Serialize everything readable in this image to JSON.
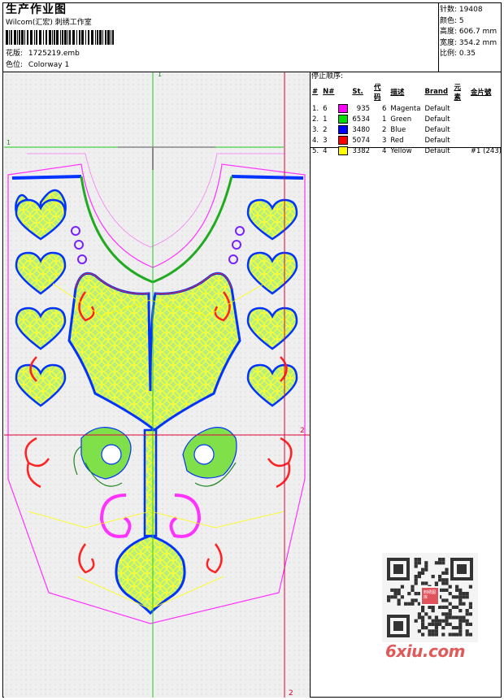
{
  "header": {
    "title": "生产作业图",
    "company": "Wilcom(汇宏) 刺绣工作室",
    "design_label": "花版:",
    "design_value": "1725219.emb",
    "colorway_label": "色位:",
    "colorway_value": "Colorway 1"
  },
  "stats": [
    {
      "label": "针数",
      "value": "19408"
    },
    {
      "label": "颜色",
      "value": "5"
    },
    {
      "label": "高度",
      "value": "606.7 mm"
    },
    {
      "label": "宽度",
      "value": "354.2 mm"
    },
    {
      "label": "比例",
      "value": "0.35"
    }
  ],
  "sequence": {
    "title": "停止顺序:",
    "headers": [
      "#",
      "N#",
      "St.",
      "代码",
      "描述",
      "Brand",
      "元素",
      "金片號"
    ],
    "rows": [
      {
        "idx": "1.",
        "n": "6",
        "color": "#ff00ff",
        "st": "935",
        "code": "6",
        "desc": "Magenta",
        "brand": "Default",
        "element": "",
        "sequin": ""
      },
      {
        "idx": "2.",
        "n": "1",
        "color": "#00dd00",
        "st": "6534",
        "code": "1",
        "desc": "Green",
        "brand": "Default",
        "element": "",
        "sequin": ""
      },
      {
        "idx": "3.",
        "n": "2",
        "color": "#0000ff",
        "st": "3480",
        "code": "2",
        "desc": "Blue",
        "brand": "Default",
        "element": "",
        "sequin": ""
      },
      {
        "idx": "4.",
        "n": "3",
        "color": "#ff0000",
        "st": "5074",
        "code": "3",
        "desc": "Red",
        "brand": "Default",
        "element": "",
        "sequin": ""
      },
      {
        "idx": "5.",
        "n": "4",
        "color": "#ffff00",
        "st": "3382",
        "code": "4",
        "desc": "Yellow",
        "brand": "Default",
        "element": "",
        "sequin": "#1 (243)"
      }
    ]
  },
  "canvas": {
    "guide_labels": {
      "top_green": "1",
      "left_green": "1",
      "right_red": "2",
      "bottom_red": "2"
    }
  },
  "watermark": "6xiu.com",
  "qr_badge": "刺绣图库"
}
